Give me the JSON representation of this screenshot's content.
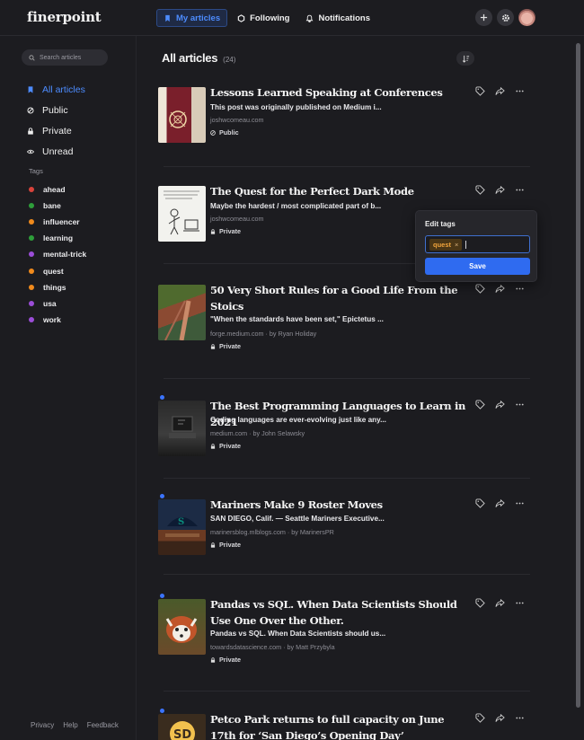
{
  "app": {
    "logo": "finerpoint"
  },
  "header": {
    "nav": [
      {
        "label": "My articles",
        "icon": "bookmark-icon"
      },
      {
        "label": "Following",
        "icon": "following-icon"
      },
      {
        "label": "Notifications",
        "icon": "bell-icon"
      }
    ]
  },
  "sidebar": {
    "search_placeholder": "Search articles",
    "items": [
      {
        "label": "All articles",
        "icon": "bookmark-icon"
      },
      {
        "label": "Public",
        "icon": "globe-icon"
      },
      {
        "label": "Private",
        "icon": "lock-icon"
      },
      {
        "label": "Unread",
        "icon": "eye-icon"
      }
    ],
    "tags_heading": "Tags",
    "tags": [
      {
        "label": "ahead",
        "color": "#d9433b"
      },
      {
        "label": "bane",
        "color": "#2e9e3a"
      },
      {
        "label": "influencer",
        "color": "#f08a1c"
      },
      {
        "label": "learning",
        "color": "#2e9e3a"
      },
      {
        "label": "mental-trick",
        "color": "#9b4dd8"
      },
      {
        "label": "quest",
        "color": "#f08a1c"
      },
      {
        "label": "things",
        "color": "#f08a1c"
      },
      {
        "label": "usa",
        "color": "#9b4dd8"
      },
      {
        "label": "work",
        "color": "#9b4dd8"
      }
    ],
    "footer": {
      "privacy": "Privacy",
      "help": "Help",
      "feedback": "Feedback"
    }
  },
  "main": {
    "title": "All articles",
    "count": "(24)",
    "articles": [
      {
        "title": "Lessons Learned Speaking at Conferences",
        "excerpt": "This post was originally published on Medium i...",
        "source": "joshwcomeau.com",
        "visibility": "Public",
        "unread": false
      },
      {
        "title": "The Quest for the Perfect Dark Mode",
        "excerpt": "Maybe the hardest / most complicated part of b...",
        "source": "joshwcomeau.com",
        "visibility": "Private",
        "unread": false
      },
      {
        "title": "50 Very Short Rules for a Good Life From the Stoics",
        "excerpt": "\"When the standards have been set,\" Epictetus ...",
        "source": "forge.medium.com",
        "author": "by Ryan Holiday",
        "visibility": "Private",
        "unread": false
      },
      {
        "title": "The Best Programming Languages to Learn in 2021",
        "excerpt": "Coding languages are ever-evolving just like any...",
        "source": "medium.com",
        "author": "by John Selawsky",
        "visibility": "Private",
        "unread": true
      },
      {
        "title": "Mariners Make 9 Roster Moves",
        "excerpt": "SAN DIEGO, Calif. — Seattle Mariners Executive...",
        "source": "marinersblog.mlblogs.com",
        "author": "by MarinersPR",
        "visibility": "Private",
        "unread": true
      },
      {
        "title": "Pandas vs SQL. When Data Scientists Should Use One Over the Other.",
        "excerpt": "Pandas vs SQL. When Data Scientists should us...",
        "source": "towardsdatascience.com",
        "author": "by Matt Przybyla",
        "visibility": "Private",
        "unread": true
      },
      {
        "title": "Petco Park returns to full capacity on June 17th for ‘San Diego’s Opening Day’",
        "unread": true
      }
    ]
  },
  "edit_tags": {
    "title": "Edit tags",
    "chip": "quest",
    "chip_remove": "×",
    "save_label": "Save"
  },
  "colors": {
    "accent": "#4d8cff",
    "save": "#2f6bf0",
    "chip": "#f1a43c"
  }
}
